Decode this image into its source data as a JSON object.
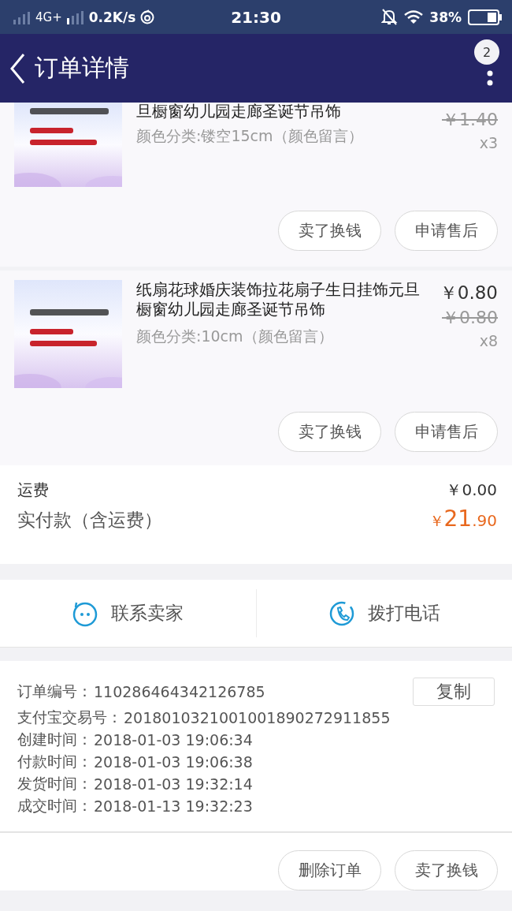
{
  "status_bar": {
    "network": "4G+",
    "speed": "0.2K/s",
    "time": "21:30",
    "battery": "38%"
  },
  "nav": {
    "title": "订单详情",
    "badge": "2"
  },
  "items": [
    {
      "title": "旦橱窗幼儿园走廊圣诞节吊饰",
      "variant": "颜色分类:镂空15cm（颜色留言）",
      "original_price": "￥1.40",
      "quantity": "x3",
      "picture": {
        "cropped": true
      },
      "actions": [
        "卖了换钱",
        "申请售后"
      ]
    },
    {
      "title": "纸扇花球婚庆装饰拉花扇子生日挂饰元旦橱窗幼儿园走廊圣诞节吊饰",
      "variant": "颜色分类:10cm（颜色留言）",
      "price": "￥0.80",
      "original_price": "￥0.80",
      "quantity": "x8",
      "picture": {
        "cropped": false
      },
      "actions": [
        "卖了换钱",
        "申请售后"
      ]
    }
  ],
  "summary": {
    "shipping_label": "运费",
    "shipping_value": "￥0.00",
    "total_label": "实付款（含运费）",
    "total": {
      "currency": "￥",
      "integer": "21",
      "decimal": ".90"
    }
  },
  "contact": [
    {
      "kind": "chat",
      "label": "联系卖家"
    },
    {
      "kind": "phone",
      "label": "拨打电话"
    }
  ],
  "order_info": {
    "copy_button": "复制",
    "rows": [
      {
        "label": "订单编号：",
        "value": "110286464342126785"
      },
      {
        "label": "支付宝交易号：",
        "value": "2018010321001001890272911855"
      },
      {
        "label": "创建时间：",
        "value": "2018-01-03 19:06:34"
      },
      {
        "label": "付款时间：",
        "value": "2018-01-03 19:06:38"
      },
      {
        "label": "发货时间：",
        "value": "2018-01-03 19:32:14"
      },
      {
        "label": "成交时间：",
        "value": "2018-01-13 19:32:23"
      }
    ]
  },
  "footer_actions": [
    "删除订单",
    "卖了换钱"
  ]
}
